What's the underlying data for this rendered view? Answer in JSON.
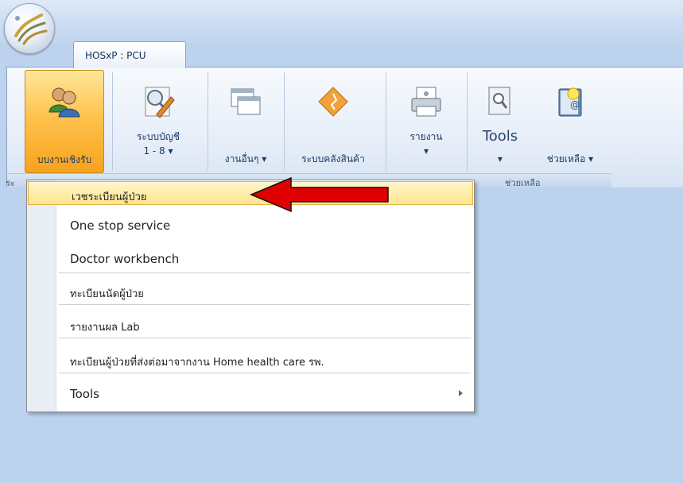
{
  "app": {
    "tab_title": "HOSxP : PCU"
  },
  "ribbon": {
    "buttons": [
      {
        "label": "บบงานเชิงรับ",
        "icon": "users-icon"
      },
      {
        "label": "ระบบบัญชี",
        "label2": "1 - 8 ▾",
        "icon": "magnifier-pencil-icon"
      },
      {
        "label": "งานอื่นๆ ▾",
        "icon": "windows-icon"
      },
      {
        "label": "ระบบคลังสินค้า",
        "icon": "diamond-icon"
      },
      {
        "label": "รายงาน",
        "label2": "▾",
        "icon": "printer-icon"
      },
      {
        "label": "Tools",
        "label2": "▾",
        "icon": "tools-doc-icon"
      },
      {
        "label": "ช่วยเหลือ ▾",
        "icon": "help-book-icon"
      }
    ],
    "group_left_label": "ระ",
    "group_help_label": "ช่วยเหลือ"
  },
  "menu": {
    "items": [
      {
        "label": "เวชระเบียนผู้ป่วย"
      },
      {
        "label": "One stop service"
      },
      {
        "label": "Doctor workbench"
      },
      {
        "label": "ทะเบียนนัดผู้ป่วย"
      },
      {
        "label": "รายงานผล Lab"
      },
      {
        "label": "ทะเบียนผู้ป่วยที่ส่งต่อมาจากงาน Home health care รพ."
      },
      {
        "label": "Tools"
      }
    ]
  },
  "colors": {
    "highlight": "#ffe58f",
    "arrow": "#e00000",
    "ribbon_active": "#ffc24d"
  }
}
